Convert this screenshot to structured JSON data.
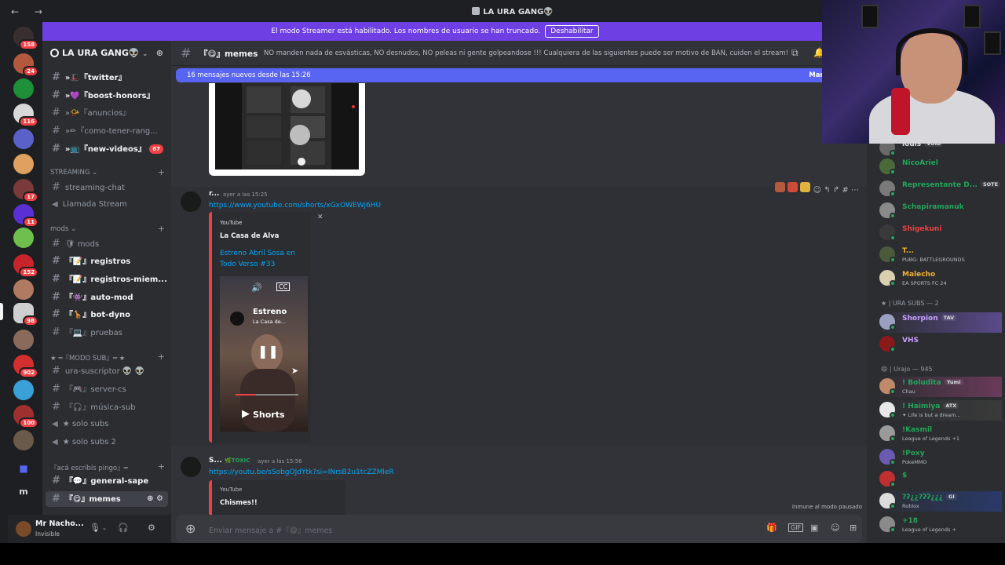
{
  "window": {
    "title": "LA URA GANG👽",
    "nav": "← →"
  },
  "banner": {
    "text": "El modo Streamer está habilitado. Los nombres de usuario se han truncado.",
    "button": "Deshabilitar"
  },
  "rail": {
    "badges": [
      "158",
      "24",
      "116",
      "17",
      "11",
      "152",
      "98",
      "902",
      "100"
    ],
    "bottom_letter": "m"
  },
  "sidebar": {
    "server_name": "LA URA GANG👽",
    "channels": [
      {
        "label": "»🎩『twitter』"
      },
      {
        "label": "»💜『boost-honors』"
      },
      {
        "label": "»📯『anuncios』"
      },
      {
        "label": "»✏『como-tener-rang..."
      },
      {
        "label": "»📺『new-videos』",
        "badge": "67"
      }
    ],
    "cat_streaming": "STREAMING",
    "streaming": [
      {
        "label": "streaming-chat"
      },
      {
        "label": "Llamada Stream"
      }
    ],
    "cat_mods": "mods",
    "mods": [
      {
        "label": "🛡 mods"
      },
      {
        "label": "『📝』registros"
      },
      {
        "label": "『📝』registros-miem..."
      },
      {
        "label": "『👾』auto-mod"
      },
      {
        "label": "『🦒』bot-dyno"
      },
      {
        "label": "『💻』pruebas"
      }
    ],
    "cat_sub": "★ ═『MODO SUB』═ ★",
    "sub": [
      {
        "label": "ura-suscriptor 👽 👽"
      },
      {
        "label": "『🎮』server-cs"
      },
      {
        "label": "『🎧』música-sub"
      },
      {
        "label": "★ solo subs"
      },
      {
        "label": "★ solo subs 2"
      }
    ],
    "cat_general": "『acá escribís pingo』═",
    "general": [
      {
        "label": "『💬』general-sape"
      },
      {
        "label": "『😋』memes"
      }
    ]
  },
  "user": {
    "name": "Mr Nacho...",
    "status": "Invisible"
  },
  "chat": {
    "channel": "『😋』memes",
    "topic": "NO manden nada de esvásticas, NO desnudos, NO peleas ni gente golpeandose !!! Cualquiera de las siguientes puede ser motivo de BAN, cuiden el stream!",
    "newbar": "16 mensajes nuevos desde las 15:26",
    "newbar_mark": "Marcar como l",
    "msg1": {
      "user": "r...",
      "time": "ayer a las 15:25",
      "link": "https://www.youtube.com/shorts/xGxOWEWj6HU",
      "embed": {
        "provider": "YouTube",
        "author": "La Casa de Alva",
        "title": "Estreno Abril Sosa en Todo Verso #33",
        "video_title": "Estreno",
        "video_sub": "La Casa de...",
        "shorts": "Shorts"
      }
    },
    "msg2": {
      "user": "S...",
      "tag": "TOXIC",
      "time": "ayer a las 15:56",
      "link": "https://youtu.be/sSobgOJdYtk?si=INrsB2u1tcZZMleR",
      "embed_provider": "YouTube",
      "embed_title": "Chismes!!"
    },
    "paused": "Inmune al modo pausado",
    "composer_placeholder": "Enviar mensaje a #『😋』memes"
  },
  "members": {
    "top": [
      {
        "name": "louis",
        "tag": "VOID",
        "color": "#dbdee1",
        "activity": ""
      },
      {
        "name": "NicoAriel",
        "tag": "",
        "color": "#23a55a",
        "activity": ""
      },
      {
        "name": "Representante D...",
        "tag": "SOTE",
        "color": "#23a55a",
        "activity": ""
      },
      {
        "name": "Schapiramanuk",
        "tag": "",
        "color": "#23a55a",
        "activity": ""
      },
      {
        "name": "Shigekuni",
        "tag": "",
        "color": "#f23f43",
        "activity": ""
      },
      {
        "name": "T...",
        "tag": "",
        "color": "#f0b232",
        "activity": "PUBG: BATTLEGROUNDS"
      },
      {
        "name": "Malecho",
        "tag": "",
        "color": "#f0b232",
        "activity": "EA SPORTS FC 24"
      }
    ],
    "cat_subs": "★ | URA SUBS — 2",
    "subs": [
      {
        "name": "Shorpion",
        "tag": "TAV",
        "color": "#c9a0ff",
        "activity": ""
      },
      {
        "name": "VHS",
        "tag": "",
        "color": "#c9a0ff",
        "activity": ""
      }
    ],
    "cat_urajo": "😄 | Urajo — 945",
    "urajo": [
      {
        "name": "! Boludita",
        "tag": "Yumi",
        "color": "#23a55a",
        "activity": "Chau"
      },
      {
        "name": "! Haimiya",
        "tag": "ATX",
        "color": "#23a55a",
        "activity": "✦ Life is but a dream..."
      },
      {
        "name": "!Kasmil",
        "tag": "",
        "color": "#23a55a",
        "activity": "League of Legends +1"
      },
      {
        "name": "!Poxy",
        "tag": "",
        "color": "#23a55a",
        "activity": "PokeMMO"
      },
      {
        "name": "$",
        "tag": "",
        "color": "#23a55a",
        "activity": ""
      },
      {
        "name": "?ʔ¿¿?ʔʔ¿¿¿",
        "tag": "GI",
        "color": "#23a55a",
        "activity": "Roblox"
      },
      {
        "name": "+18",
        "tag": "",
        "color": "#23a55a",
        "activity": "League of Legends +"
      }
    ]
  },
  "colors": {
    "accent": "#5865f2",
    "banner": "#6e3fe2",
    "link": "#00a8fc",
    "online": "#23a55a",
    "danger": "#f23f43"
  },
  "icons": [
    "back-icon",
    "forward-icon",
    "hash-icon",
    "speaker-icon",
    "add-user-icon",
    "mic-icon",
    "headphones-icon",
    "gear-icon",
    "plus-icon",
    "gift-icon",
    "gif-icon",
    "sticker-icon",
    "emoji-icon",
    "apps-icon",
    "reply-icon",
    "forward-msg-icon",
    "more-icon",
    "pause-icon",
    "volume-icon",
    "cc-icon"
  ]
}
